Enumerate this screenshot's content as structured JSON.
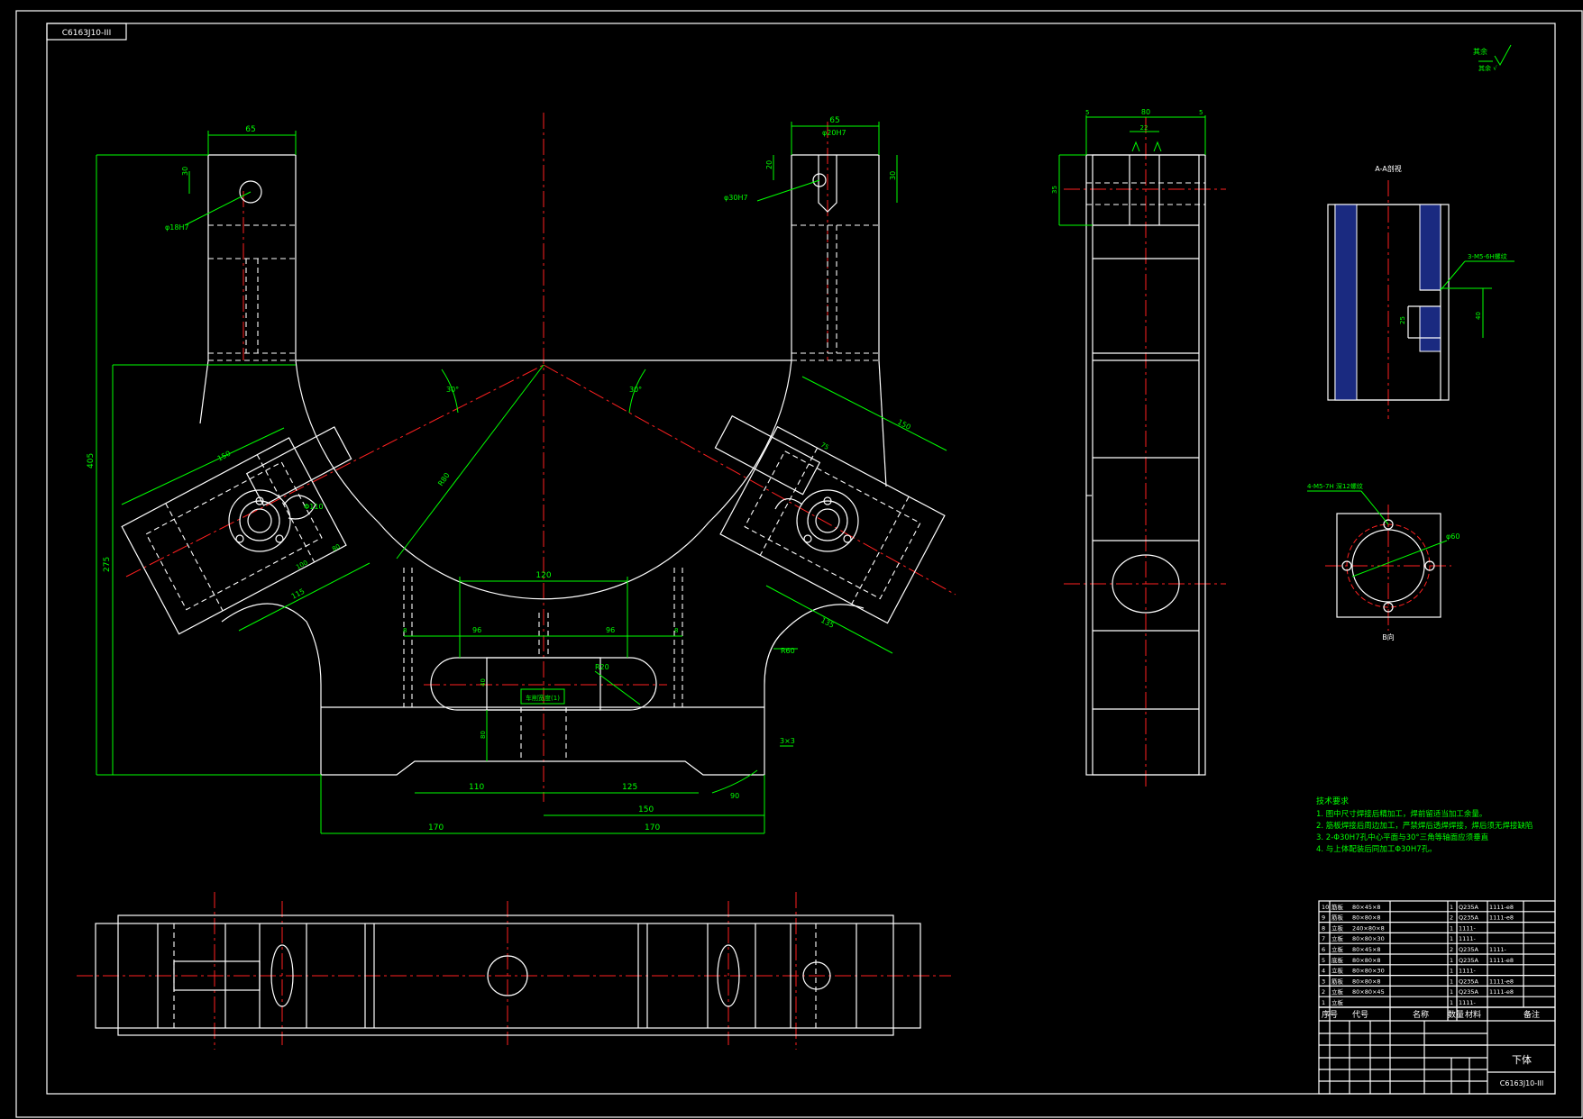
{
  "drawing": {
    "code_tag": "C6163J10-III",
    "title": "下体",
    "code_bottom": "C6163J10-III",
    "roughness_note": "其余"
  },
  "views": {
    "section_label": "A-A剖视",
    "view_b_label": "B向",
    "hole_note_1": "3-M5-6H螺纹",
    "hole_note_2": "4-M5-7H 深12螺纹",
    "slot_note": "车削宽度(1)"
  },
  "dimensions": {
    "top_left_width": "65",
    "top_right_width": "65",
    "top_left_bore": "φ18H7",
    "top_right_bore": "φ20H7",
    "top_right_bore2": "φ30H7",
    "d_30": "30",
    "d_20": "20",
    "height_total": "405",
    "height_inner": "275",
    "radius_main": "R80",
    "angle_left": "30°",
    "angle_right": "30°",
    "slot_width": "120",
    "slot_96a": "96",
    "slot_96b": "96",
    "slot_r20": "R20",
    "slot_40": "40",
    "slot_80": "80",
    "b8a": "8",
    "b8b": "8",
    "bot_110": "110",
    "bot_125": "125",
    "bot_150": "150",
    "bot_170a": "170",
    "bot_170b": "170",
    "chamfer": "3×3",
    "d_90": "90",
    "r_60": "R60",
    "left_150": "150",
    "left_115": "115",
    "left_100": "100",
    "left_80": "80",
    "left_d110": "Φ110",
    "right_135": "135",
    "right_75": "75",
    "right_150": "150",
    "side_80": "80",
    "side_22": "22",
    "side_5a": "5",
    "side_5b": "5",
    "side_35": "35",
    "sec_25": "25",
    "sec_40": "40",
    "b_d60": "φ60"
  },
  "tech_notes": {
    "heading": "技术要求",
    "lines": [
      "1. 图中尺寸焊接后精加工，焊前留适当加工余量。",
      "2. 筋板焊接后周边加工，严禁焊后透焊焊接，焊后须无焊接缺陷",
      "3. 2-Φ30H7孔中心平面与30°三角等轴面应须垂直",
      "4. 与上体配装后同加工Φ30H7孔。"
    ]
  },
  "bom": {
    "rows": [
      {
        "no": "10",
        "name": "筋板",
        "spec": "80×45×8",
        "qty": "1",
        "mat": "Q235A",
        "note": "1111-e8"
      },
      {
        "no": "9",
        "name": "筋板",
        "spec": "80×80×8",
        "qty": "2",
        "mat": "Q235A",
        "note": "1111-e8"
      },
      {
        "no": "8",
        "name": "立板",
        "spec": "240×80×8",
        "qty": "1",
        "mat": "1111-",
        "note": ""
      },
      {
        "no": "7",
        "name": "立板",
        "spec": "80×80×30",
        "qty": "1",
        "mat": "1111-",
        "note": ""
      },
      {
        "no": "6",
        "name": "立板",
        "spec": "80×45×8",
        "qty": "2",
        "mat": "Q235A",
        "note": "1111-"
      },
      {
        "no": "5",
        "name": "底板",
        "spec": "80×80×8",
        "qty": "1",
        "mat": "Q235A",
        "note": "1111-e8"
      },
      {
        "no": "4",
        "name": "立板",
        "spec": "80×80×30",
        "qty": "1",
        "mat": "1111-",
        "note": ""
      },
      {
        "no": "3",
        "name": "筋板",
        "spec": "80×80×8",
        "qty": "1",
        "mat": "Q235A",
        "note": "1111-e8"
      },
      {
        "no": "2",
        "name": "立板",
        "spec": "80×80×45",
        "qty": "1",
        "mat": "Q235A",
        "note": "1111-e8"
      },
      {
        "no": "1",
        "name": "立板",
        "spec": "",
        "qty": "1",
        "mat": "1111-",
        "note": ""
      }
    ],
    "header": [
      "序号",
      "代号",
      "名称",
      "数量",
      "材料",
      "备注"
    ]
  }
}
